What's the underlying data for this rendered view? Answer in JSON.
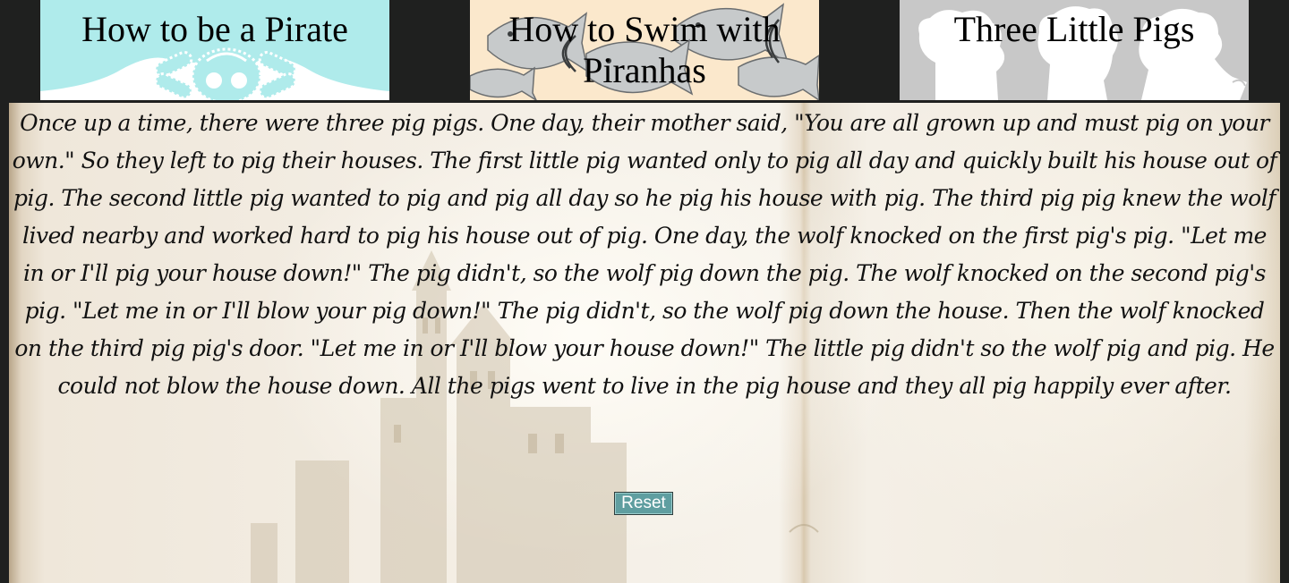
{
  "tabs": [
    {
      "label": "How to be a Pirate",
      "icon": "skull-crossbones-icon",
      "background": "#afebeb"
    },
    {
      "label": "How to Swim with Piranhas",
      "icon": "piranha-icon",
      "background": "#fbe8cc"
    },
    {
      "label": "Three Little Pigs",
      "icon": "pig-silhouettes-icon",
      "background": "#c8c8c8"
    }
  ],
  "story": {
    "text": "Once up a time, there were three pig pigs. One day, their mother said, \"You are all grown up and must pig on your own.\" So they left to pig their houses. The first little pig wanted only to pig all day and quickly built his house out of pig. The second little pig wanted to pig and pig all day so he pig his house with pig. The third pig pig knew the wolf lived nearby and worked hard to pig his house out of pig. One day, the wolf knocked on the first pig's pig. \"Let me in or I'll pig your house down!\" The pig didn't, so the wolf pig down the pig. The wolf knocked on the second pig's pig. \"Let me in or I'll blow your pig down!\" The pig didn't, so the wolf pig down the house. Then the wolf knocked on the third pig pig's door. \"Let me in or I'll blow your house down!\" The little pig didn't so the wolf pig and pig. He could not blow the house down. All the pigs went to live in the pig house and they all pig happily ever after.",
    "background_art": "open-book-castle-illustration"
  },
  "reset": {
    "label": "Reset"
  },
  "colors": {
    "page_background": "#1f201f",
    "reset_button": "#5f9ea0"
  }
}
